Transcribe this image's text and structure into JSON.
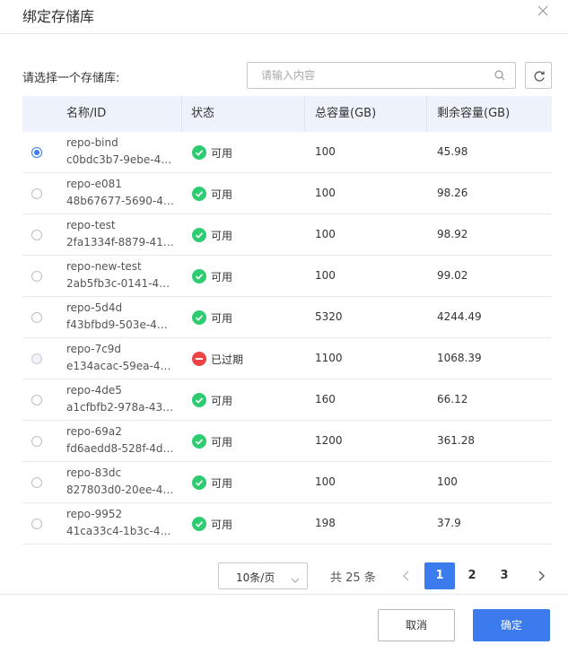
{
  "dialog": {
    "title": "绑定存储库"
  },
  "toolbar": {
    "select_label": "请选择一个存储库:",
    "search_placeholder": "请输入内容",
    "search_value": ""
  },
  "table": {
    "columns": [
      "名称/ID",
      "状态",
      "总容量(GB)",
      "剩余容量(GB)"
    ],
    "rows": [
      {
        "name": "repo-bind",
        "id": "c0bdc3b7-9ebe-4…",
        "status": "可用",
        "status_type": "ok",
        "total": "100",
        "remaining": "45.98",
        "selected": true
      },
      {
        "name": "repo-e081",
        "id": "48b67677-5690-4f…",
        "status": "可用",
        "status_type": "ok",
        "total": "100",
        "remaining": "98.26",
        "selected": false
      },
      {
        "name": "repo-test",
        "id": "2fa1334f-8879-41…",
        "status": "可用",
        "status_type": "ok",
        "total": "100",
        "remaining": "98.92",
        "selected": false
      },
      {
        "name": "repo-new-test",
        "id": "2ab5fb3c-0141-45…",
        "status": "可用",
        "status_type": "ok",
        "total": "100",
        "remaining": "99.02",
        "selected": false
      },
      {
        "name": "repo-5d4d",
        "id": "f43bfbd9-503e-44…",
        "status": "可用",
        "status_type": "ok",
        "total": "5320",
        "remaining": "4244.49",
        "selected": false
      },
      {
        "name": "repo-7c9d",
        "id": "e134acac-59ea-4b…",
        "status": "已过期",
        "status_type": "expired",
        "total": "1100",
        "remaining": "1068.39",
        "selected": false
      },
      {
        "name": "repo-4de5",
        "id": "a1cfbfb2-978a-43…",
        "status": "可用",
        "status_type": "ok",
        "total": "160",
        "remaining": "66.12",
        "selected": false
      },
      {
        "name": "repo-69a2",
        "id": "fd6aedd8-528f-4d…",
        "status": "可用",
        "status_type": "ok",
        "total": "1200",
        "remaining": "361.28",
        "selected": false
      },
      {
        "name": "repo-83dc",
        "id": "827803d0-20ee-4…",
        "status": "可用",
        "status_type": "ok",
        "total": "100",
        "remaining": "100",
        "selected": false
      },
      {
        "name": "repo-9952",
        "id": "41ca33c4-1b3c-4b…",
        "status": "可用",
        "status_type": "ok",
        "total": "198",
        "remaining": "37.9",
        "selected": false
      }
    ]
  },
  "pagination": {
    "page_size_label": "10条/页",
    "total_text": "共 25 条",
    "pages": [
      "1",
      "2",
      "3"
    ],
    "current_page": "1"
  },
  "footer": {
    "cancel_label": "取消",
    "ok_label": "确定"
  },
  "colors": {
    "primary": "#3b7bed",
    "status_ok": "#2ecc71",
    "status_expired": "#ef4343",
    "header_bg": "#eef3fb"
  },
  "icons": {
    "close": "close-icon",
    "search": "search-icon",
    "refresh": "refresh-icon",
    "ok": "check-circle-icon",
    "expired": "minus-circle-icon"
  }
}
